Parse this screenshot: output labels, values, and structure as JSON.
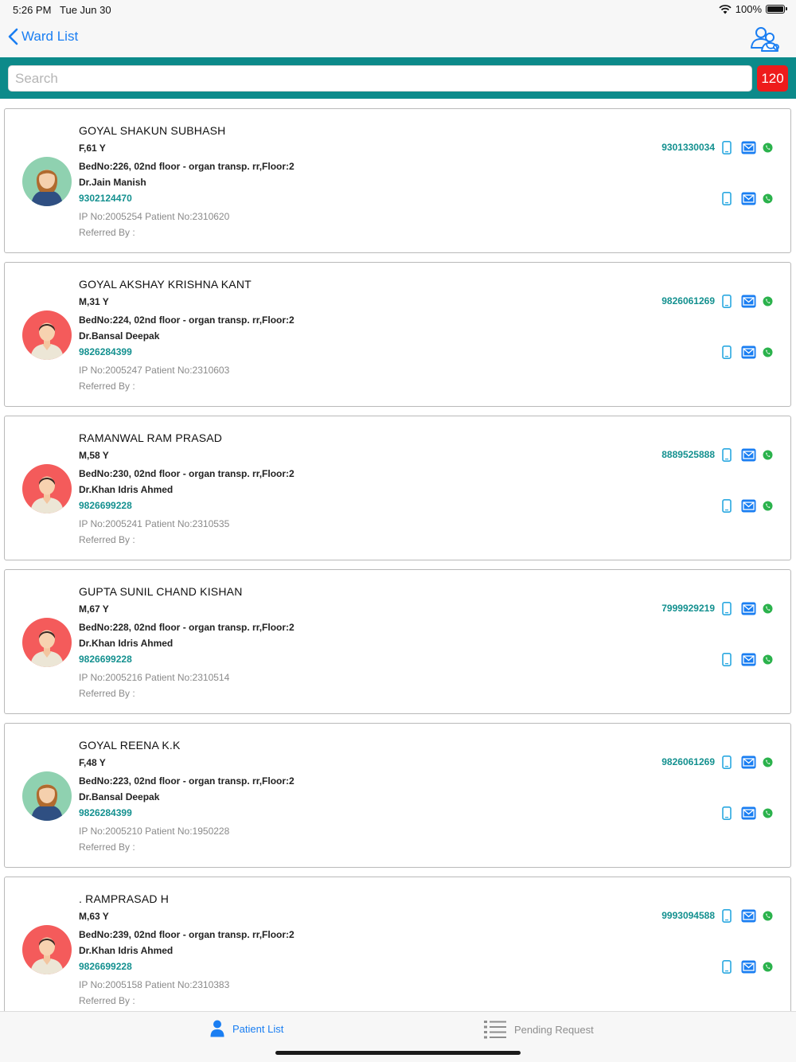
{
  "status_bar": {
    "time": "5:26 PM",
    "date": "Tue Jun 30",
    "battery": "100%",
    "battery_level": 1.0
  },
  "nav": {
    "back_label": "Ward List",
    "back_icon": "chevron-left-icon",
    "action_icon": "doctors-group-icon"
  },
  "search": {
    "placeholder": "Search",
    "value": "",
    "count": "120"
  },
  "colors": {
    "teal": "#0c8a8a",
    "accent_blue": "#1a7ef2",
    "phone_green": "#13908f",
    "badge_red": "#ee1b1b"
  },
  "patients": [
    {
      "name": "GOYAL SHAKUN SUBHASH",
      "sex_age": "F,61 Y",
      "bed": "BedNo:226, 02nd floor - organ transp. rr,Floor:2",
      "doctor": "Dr.Jain Manish",
      "doctor_phone": "9302124470",
      "ids": "IP No:2005254 Patient No:2310620",
      "referred_by": "Referred By :",
      "phone": "9301330034",
      "gender": "female"
    },
    {
      "name": "GOYAL AKSHAY KRISHNA KANT",
      "sex_age": "M,31 Y",
      "bed": "BedNo:224, 02nd floor - organ transp. rr,Floor:2",
      "doctor": "Dr.Bansal Deepak",
      "doctor_phone": "9826284399",
      "ids": "IP No:2005247 Patient No:2310603",
      "referred_by": "Referred By :",
      "phone": "9826061269",
      "gender": "male"
    },
    {
      "name": "RAMANWAL RAM PRASAD",
      "sex_age": "M,58 Y",
      "bed": "BedNo:230, 02nd floor - organ transp. rr,Floor:2",
      "doctor": "Dr.Khan Idris Ahmed",
      "doctor_phone": "9826699228",
      "ids": "IP No:2005241 Patient No:2310535",
      "referred_by": "Referred By :",
      "phone": "8889525888",
      "gender": "male"
    },
    {
      "name": "GUPTA SUNIL CHAND KISHAN",
      "sex_age": "M,67 Y",
      "bed": "BedNo:228, 02nd floor - organ transp. rr,Floor:2",
      "doctor": "Dr.Khan Idris Ahmed",
      "doctor_phone": "9826699228",
      "ids": "IP No:2005216 Patient No:2310514",
      "referred_by": "Referred By :",
      "phone": "7999929219",
      "gender": "male"
    },
    {
      "name": "GOYAL REENA K.K",
      "sex_age": "F,48 Y",
      "bed": "BedNo:223, 02nd floor - organ transp. rr,Floor:2",
      "doctor": "Dr.Bansal Deepak",
      "doctor_phone": "9826284399",
      "ids": "IP No:2005210 Patient No:1950228",
      "referred_by": "Referred By :",
      "phone": "9826061269",
      "gender": "female"
    },
    {
      "name": ". RAMPRASAD H",
      "sex_age": "M,63 Y",
      "bed": "BedNo:239, 02nd floor - organ transp. rr,Floor:2",
      "doctor": "Dr.Khan Idris Ahmed",
      "doctor_phone": "9826699228",
      "ids": "IP No:2005158 Patient No:2310383",
      "referred_by": "Referred By :",
      "phone": "9993094588",
      "gender": "male"
    }
  ],
  "tabs": [
    {
      "label": "Patient List",
      "icon": "person-icon",
      "active": true
    },
    {
      "label": "Pending Request",
      "icon": "list-icon",
      "active": false
    }
  ]
}
